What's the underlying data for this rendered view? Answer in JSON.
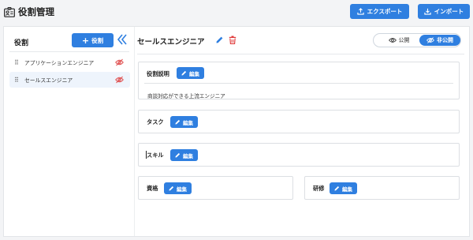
{
  "header": {
    "title": "役割管理",
    "export_label": "エクスポート",
    "import_label": "インポート"
  },
  "sidebar": {
    "title": "役割",
    "add_label": "役割",
    "items": [
      {
        "label": "アプリケーションエンジニア",
        "selected": false
      },
      {
        "label": "セールスエンジニア",
        "selected": true
      }
    ]
  },
  "main": {
    "role_name": "セールスエンジニア",
    "visibility": {
      "public_label": "公開",
      "private_label": "非公開",
      "selected": "private"
    },
    "edit_label": "編集",
    "sections": {
      "description": {
        "title": "役割説明",
        "text": "商談対応ができる上流エンジニア"
      },
      "tasks": {
        "title": "タスク"
      },
      "skills": {
        "title": "スキル"
      },
      "qualifications": {
        "title": "資格"
      },
      "training": {
        "title": "研修"
      }
    }
  },
  "colors": {
    "accent": "#2f7fe0",
    "danger": "#e03b3b",
    "hidden_icon": "#e05252"
  }
}
